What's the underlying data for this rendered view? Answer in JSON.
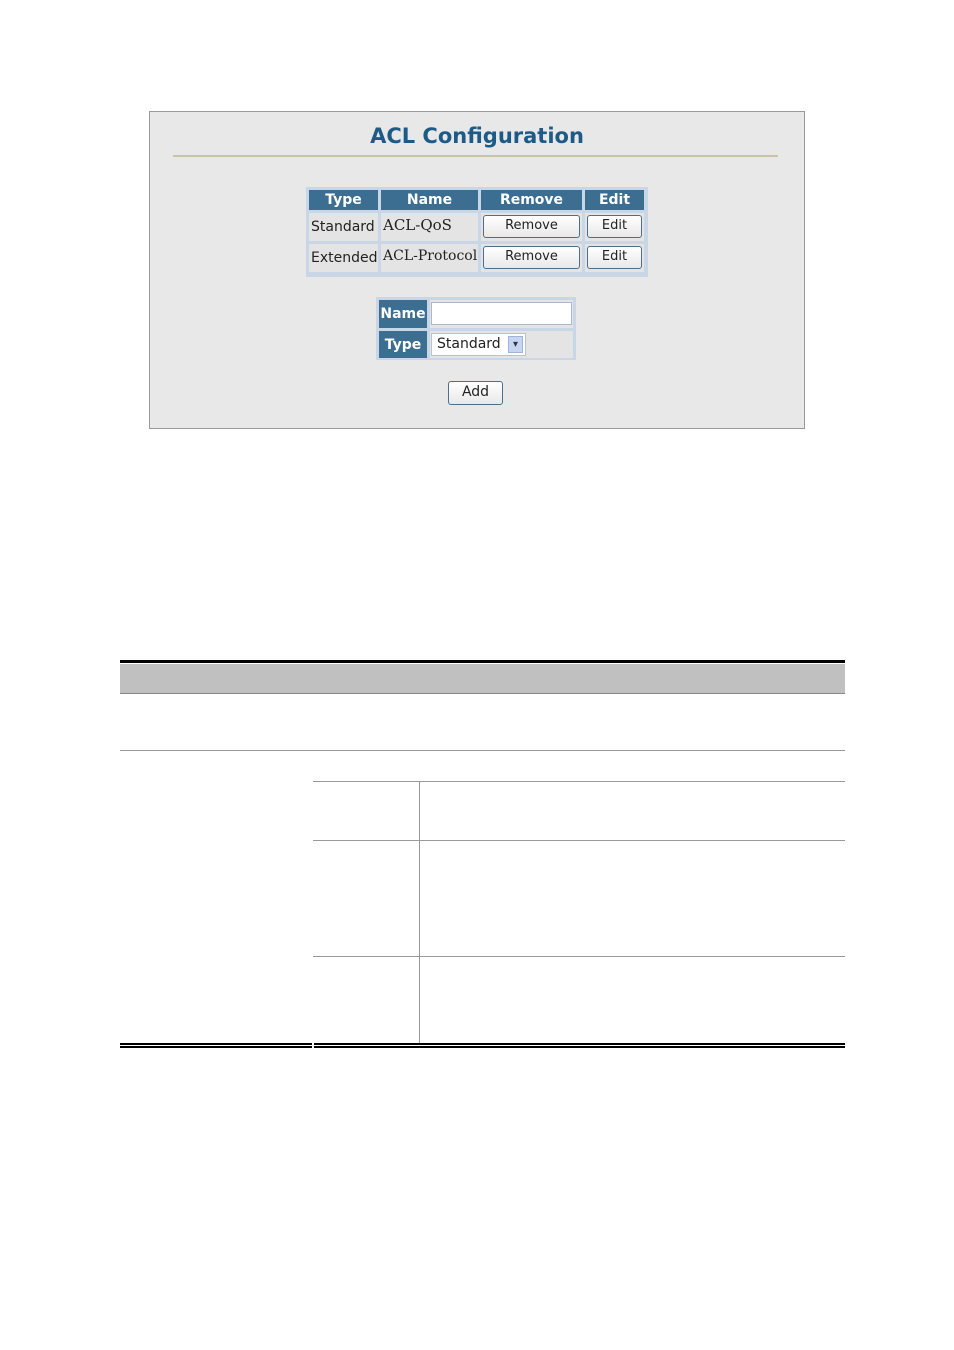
{
  "panel": {
    "title": "ACL Configuration"
  },
  "acl_table": {
    "headers": [
      "Type",
      "Name",
      "Remove",
      "Edit"
    ],
    "rows": [
      {
        "type": "Standard",
        "name": "ACL-QoS",
        "remove": "Remove",
        "edit": "Edit"
      },
      {
        "type": "Extended",
        "name": "ACL-Protocol",
        "remove": "Remove",
        "edit": "Edit"
      }
    ]
  },
  "form": {
    "name_label": "Name",
    "name_value": "",
    "type_label": "Type",
    "type_value": "Standard",
    "add_label": "Add"
  },
  "colors": {
    "header": "#3c6e91",
    "title": "#1d5a86"
  }
}
